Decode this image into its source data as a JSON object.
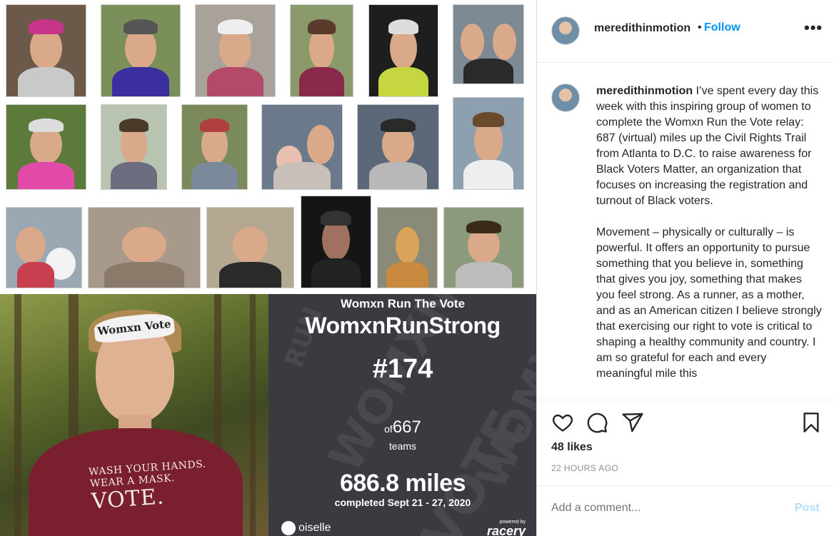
{
  "post": {
    "username": "meredithinmotion",
    "follow_label": "Follow",
    "more_label": "•••",
    "caption_username": "meredithinmotion",
    "caption_paragraph_1": "I’ve spent every day this week with this inspiring group of women to complete the Womxn Run the Vote relay: 687 (virtual) miles up the Civil Rights Trail from Atlanta to D.C. to raise awareness for Black Voters Matter, an organization that focuses on increasing the registration and turnout of Black voters.",
    "caption_paragraph_2": "Movement – physically or culturally – is powerful. It offers an opportunity to pursue something that you believe in, something that gives you joy, something that makes you feel strong. As a runner, as a mother, and as an American citizen I believe strongly that exercising our right to vote is critical to shaping a healthy community and country. I am so grateful for each and every meaningful mile this",
    "likes": "48 likes",
    "timestamp": "22 HOURS AGO",
    "comment_placeholder": "Add a comment...",
    "post_label": "Post"
  },
  "image": {
    "shirt_line_1": "WASH YOUR HANDS.",
    "shirt_line_2": "WEAR A MASK.",
    "shirt_line_3": "VOTE.",
    "headband_text": "Womxn Vote",
    "race_title": "Womxn Run The Vote",
    "team_name": "WomxnRunStrong",
    "rank": "#174",
    "of_label": "of",
    "total_teams": "667",
    "teams_label": "teams",
    "miles": "686.8 miles",
    "completed": "completed Sept 21 - 27, 2020",
    "brand_left": "oiselle",
    "powered_by": "powered by",
    "brand_right": "racery",
    "bg_words": [
      "WOMXN",
      "RUN",
      "THE",
      "VOTE"
    ]
  },
  "icons": [
    "heart-icon",
    "comment-icon",
    "share-icon",
    "bookmark-icon",
    "more-icon"
  ],
  "colors": {
    "follow": "#0095f6",
    "post_disabled": "#b2dffc",
    "race_card_bg": "#3a3b40",
    "shirt": "#7a1f2e",
    "muted_text": "#8e8e8e"
  }
}
